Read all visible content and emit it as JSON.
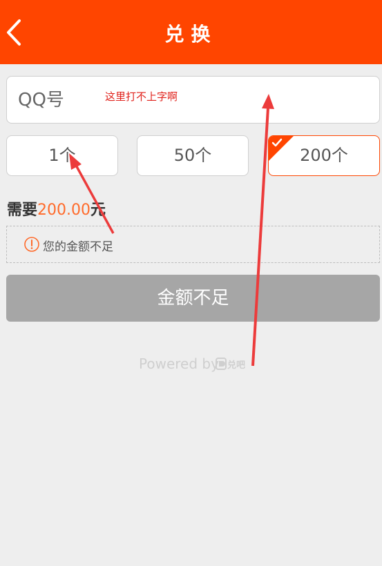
{
  "header": {
    "title": "兑换",
    "back_icon": "chevron-left-icon"
  },
  "qq_input": {
    "placeholder": "QQ号",
    "value": ""
  },
  "annotation": {
    "note": "这里打不上字啊",
    "color": "#e0201a"
  },
  "quantity_options": [
    {
      "label": "1个",
      "selected": false
    },
    {
      "label": "50个",
      "selected": false
    },
    {
      "label": "200个",
      "selected": true
    }
  ],
  "need": {
    "prefix": "需要",
    "amount": "200.00",
    "unit": "元"
  },
  "warning": {
    "icon": "exclamation-circle-icon",
    "text": "您的金额不足"
  },
  "submit_button": {
    "label": "金额不足"
  },
  "footer": {
    "powered_by": "Powered by",
    "logo_text": "兑吧"
  },
  "colors": {
    "brand": "#ff4500",
    "amount": "#ff6a2a",
    "disabled_button": "#a6a6a6",
    "background": "#eeeeee"
  }
}
